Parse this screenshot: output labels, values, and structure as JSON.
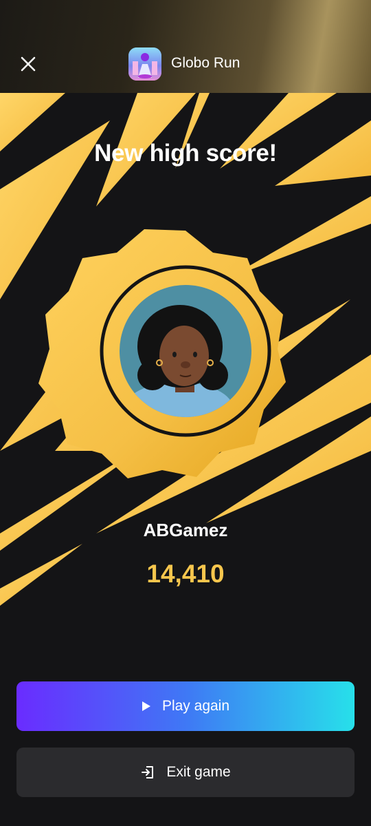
{
  "header": {
    "app_title": "Globo Run",
    "close_icon": "close-icon",
    "app_icon": "globo-run-app-icon"
  },
  "result": {
    "headline": "New high score!",
    "username": "ABGamez",
    "score": "14,410",
    "avatar": "player-avatar"
  },
  "actions": {
    "play_again_label": "Play again",
    "play_icon": "play-icon",
    "exit_label": "Exit game",
    "exit_icon": "exit-icon"
  },
  "colors": {
    "background": "#141416",
    "accent_yellow": "#f7c64d",
    "play_gradient_start": "#6a2cff",
    "play_gradient_end": "#27e0ea",
    "exit_button": "#2b2b2e"
  }
}
